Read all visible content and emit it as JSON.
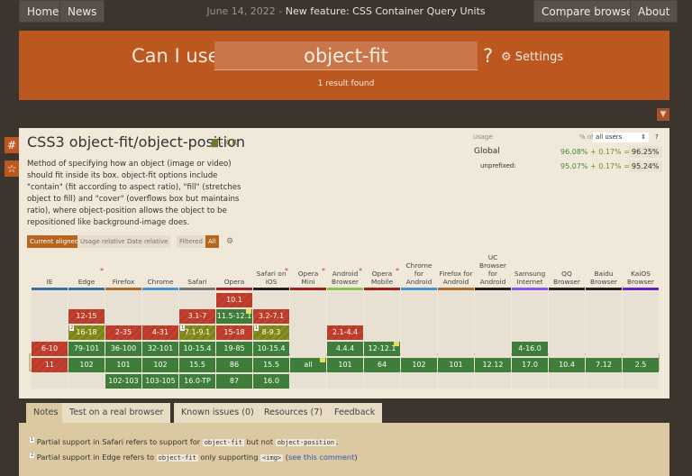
{
  "nav": {
    "home": "Home",
    "news": "News",
    "compare": "Compare browsers",
    "about": "About",
    "news_date": "June 14, 2022",
    "news_text": "New feature: CSS Container Query Units"
  },
  "search": {
    "label": "Can I use",
    "value": "object-fit",
    "question": "?",
    "settings": "Settings",
    "result": "1 result found"
  },
  "feature": {
    "title": "CSS3 object-fit/object-position",
    "status": "- CR",
    "description": "Method of specifying how an object (image or video) should fit inside its box. object-fit options include \"contain\" (fit according to aspect ratio), \"fill\" (stretches object to fill) and \"cover\" (overflows box but maintains ratio), where object-position allows the object to be repositioned like background-image does."
  },
  "view": {
    "current": "Current aligned",
    "usage": "Usage relative",
    "date": "Date relative",
    "filtered": "Filtered",
    "all": "All"
  },
  "usage": {
    "label": "Usage",
    "pct_of": "% of",
    "users": "all users",
    "help": "?",
    "global": "Global",
    "g_full": "96.08%",
    "g_part": "+ 0.17% =",
    "g_total": "96.25%",
    "unprefixed": "unprefixed:",
    "u_full": "95.07%",
    "u_part": "+ 0.17% =",
    "u_total": "95.24%"
  },
  "colors": {
    "supported": "#3e7d3a",
    "unsupported": "#c4412f",
    "partial": "#878f1e",
    "banner": "#bd5720"
  },
  "browsers": [
    {
      "name": "IE",
      "bar": "#3a6ea5",
      "star": false,
      "cells": [
        null,
        null,
        null,
        {
          "v": "6-10",
          "s": "n"
        },
        {
          "v": "11",
          "s": "n"
        },
        null
      ]
    },
    {
      "name": "Edge",
      "bar": "#3a6ea5",
      "star": true,
      "cells": [
        null,
        {
          "v": "12-15",
          "s": "n"
        },
        {
          "v": "16-18",
          "s": "a",
          "note": "2"
        },
        {
          "v": "79-101",
          "s": "y"
        },
        {
          "v": "102",
          "s": "y"
        },
        null
      ]
    },
    {
      "name": "Firefox",
      "bar": "#b0692a",
      "star": false,
      "cells": [
        null,
        null,
        {
          "v": "2-35",
          "s": "n"
        },
        {
          "v": "36-100",
          "s": "y"
        },
        {
          "v": "101",
          "s": "y"
        },
        {
          "v": "102-103",
          "s": "y"
        }
      ]
    },
    {
      "name": "Chrome",
      "bar": "#4a90d9",
      "star": false,
      "cells": [
        null,
        null,
        {
          "v": "4-31",
          "s": "n"
        },
        {
          "v": "32-101",
          "s": "y"
        },
        {
          "v": "102",
          "s": "y"
        },
        {
          "v": "103-105",
          "s": "y"
        }
      ]
    },
    {
      "name": "Safari",
      "bar": "#777777",
      "star": false,
      "cells": [
        null,
        {
          "v": "3.1-7",
          "s": "n"
        },
        {
          "v": "7.1-9.1",
          "s": "a",
          "note": "1"
        },
        {
          "v": "10-15.4",
          "s": "y"
        },
        {
          "v": "15.5",
          "s": "y"
        },
        {
          "v": "16.0-TP",
          "s": "y"
        }
      ]
    },
    {
      "name": "Opera",
      "bar": "#a02020",
      "star": false,
      "cells": [
        {
          "v": "10.1",
          "s": "n"
        },
        {
          "v": "11.5-12.1",
          "s": "y",
          "flag": true
        },
        {
          "v": "15-18",
          "s": "n"
        },
        {
          "v": "19-85",
          "s": "y"
        },
        {
          "v": "86",
          "s": "y"
        },
        {
          "v": "87",
          "s": "y"
        }
      ]
    },
    {
      "name": "Safari on iOS",
      "bar": "#222222",
      "star": true,
      "cells": [
        null,
        {
          "v": "3.2-7.1",
          "s": "n"
        },
        {
          "v": "8-9.3",
          "s": "a",
          "note": "1"
        },
        {
          "v": "10-15.4",
          "s": "y"
        },
        {
          "v": "15.5",
          "s": "y"
        },
        {
          "v": "16.0",
          "s": "y"
        }
      ]
    },
    {
      "name": "Opera Mini",
      "bar": "#a02020",
      "star": true,
      "cells": [
        null,
        null,
        null,
        null,
        {
          "v": "all",
          "s": "y",
          "flag": true
        },
        null
      ]
    },
    {
      "name": "Android Browser",
      "bar": "#8bc34a",
      "star": true,
      "cells": [
        null,
        null,
        {
          "v": "2.1-4.4",
          "s": "n"
        },
        {
          "v": "4.4.4",
          "s": "y"
        },
        {
          "v": "101",
          "s": "y"
        },
        null
      ]
    },
    {
      "name": "Opera Mobile",
      "bar": "#a02020",
      "star": true,
      "cells": [
        null,
        null,
        null,
        {
          "v": "12-12.1",
          "s": "y",
          "flag": true
        },
        {
          "v": "64",
          "s": "y"
        },
        null
      ]
    },
    {
      "name": "Chrome for Android",
      "bar": "#4a90d9",
      "star": false,
      "cells": [
        null,
        null,
        null,
        null,
        {
          "v": "102",
          "s": "y"
        },
        null
      ]
    },
    {
      "name": "Firefox for Android",
      "bar": "#b0692a",
      "star": false,
      "cells": [
        null,
        null,
        null,
        null,
        {
          "v": "101",
          "s": "y"
        },
        null
      ]
    },
    {
      "name": "UC Browser for Android",
      "bar": "#222222",
      "star": false,
      "cells": [
        null,
        null,
        null,
        null,
        {
          "v": "12.12",
          "s": "y"
        },
        null
      ]
    },
    {
      "name": "Samsung Internet",
      "bar": "#8855ee",
      "star": false,
      "cells": [
        null,
        null,
        null,
        {
          "v": "4-16.0",
          "s": "y"
        },
        {
          "v": "17.0",
          "s": "y"
        },
        null
      ]
    },
    {
      "name": "QQ Browser",
      "bar": "#222222",
      "star": false,
      "cells": [
        null,
        null,
        null,
        null,
        {
          "v": "10.4",
          "s": "y"
        },
        null
      ]
    },
    {
      "name": "Baidu Browser",
      "bar": "#222222",
      "star": false,
      "cells": [
        null,
        null,
        null,
        null,
        {
          "v": "7.12",
          "s": "y"
        },
        null
      ]
    },
    {
      "name": "KaiOS Browser",
      "bar": "#6a1fc0",
      "star": false,
      "cells": [
        null,
        null,
        null,
        null,
        {
          "v": "2.5",
          "s": "y"
        },
        null
      ]
    }
  ],
  "tabs": [
    "Notes",
    "Test on a real browser",
    "Known issues (0)",
    "Resources (7)",
    "Feedback"
  ],
  "notes": {
    "n1_a": "Partial support in Safari refers to support for",
    "n1_code1": "object-fit",
    "n1_b": "but not",
    "n1_code2": "object-position",
    "n1_c": ".",
    "n2_a": "Partial support in Edge refers to",
    "n2_code1": "object-fit",
    "n2_b": "only supporting",
    "n2_code2": "<img>",
    "n2_link": "see this comment"
  }
}
